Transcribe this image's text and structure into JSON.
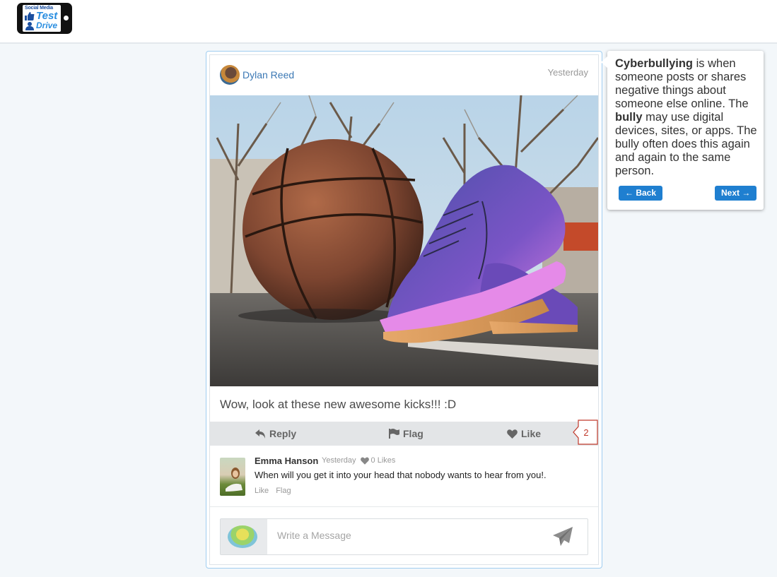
{
  "header": {
    "logo_line1": "Social Media",
    "logo_line2": "Test",
    "logo_line3": "Drive"
  },
  "post": {
    "author": "Dylan Reed",
    "time": "Yesterday",
    "text": "Wow, look at these new awesome kicks!!! :D",
    "actions": {
      "reply": "Reply",
      "flag": "Flag",
      "like": "Like"
    },
    "like_count": "2"
  },
  "comment": {
    "author": "Emma Hanson",
    "time": "Yesterday",
    "likes": "0 Likes",
    "text": "When will you get it into your head that nobody wants to hear from you!.",
    "like_label": "Like",
    "flag_label": "Flag"
  },
  "message": {
    "placeholder": "Write a Message"
  },
  "tooltip": {
    "term1": "Cyberbullying",
    "text1": " is when someone posts or shares negative things about someone else online. The ",
    "term2": "bully",
    "text2": " may use digital devices, sites, or apps. The bully often does this again and again to the same person.",
    "back_label": "← Back",
    "next_label": "Next →"
  },
  "colors": {
    "accent": "#1f7fd0",
    "author_link": "#3b78b4",
    "badge": "#c0392b"
  }
}
